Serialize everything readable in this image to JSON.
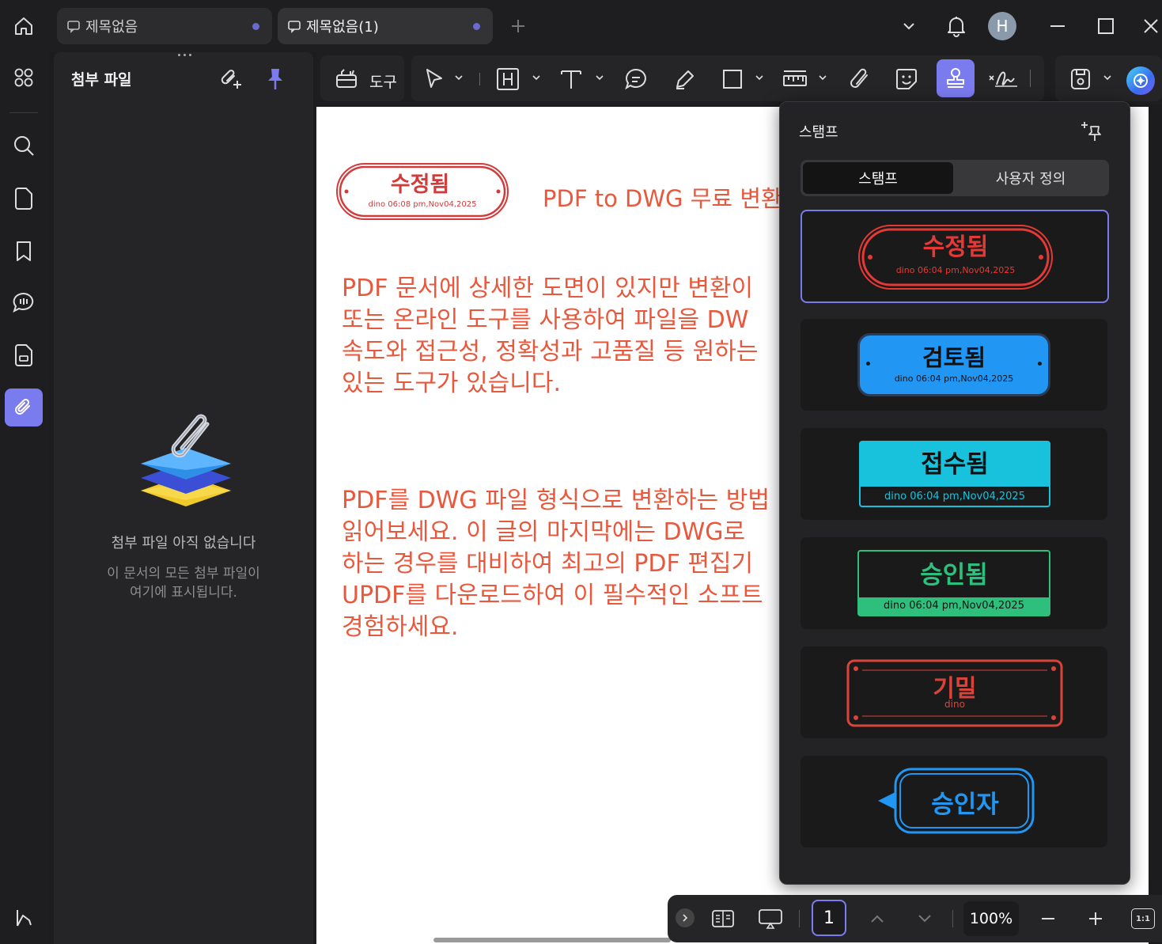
{
  "titlebar": {
    "tabs": [
      {
        "label": "제목없음"
      },
      {
        "label": "제목없음(1)"
      }
    ],
    "avatar_letter": "H"
  },
  "sidebar": {
    "title": "첨부 파일",
    "empty_title": "첨부 파일 아직 없습니다",
    "empty_desc_line1": "이 문서의 모든 첨부 파일이",
    "empty_desc_line2": "여기에 표시됩니다."
  },
  "toolbar": {
    "tools_label": "도구"
  },
  "document": {
    "stamp": {
      "title": "수정됨",
      "subtitle": "dino 06:08 pm,Nov04,2025"
    },
    "heading": "PDF to DWG 무료 변환",
    "para1": [
      "PDF 문서에 상세한 도면이 있지만 변환이",
      "또는 온라인 도구를 사용하여 파일을 DW",
      "속도와 접근성, 정확성과 고품질 등 원하는",
      "있는 도구가 있습니다."
    ],
    "para2": [
      "PDF를 DWG 파일 형식으로 변환하는 방법",
      "읽어보세요. 이 글의 마지막에는 DWG로",
      "하는 경우를 대비하여 최고의 PDF 편집기",
      "UPDF를 다운로드하여 이 필수적인 소프트",
      "경험하세요."
    ]
  },
  "stamp_panel": {
    "title": "스탬프",
    "tabs": [
      "스탬프",
      "사용자 정의"
    ],
    "stamps": [
      {
        "title": "수정됨",
        "subtitle": "dino 06:04 pm,Nov04,2025",
        "color": "#e53935"
      },
      {
        "title": "검토됨",
        "subtitle": "dino 06:04 pm,Nov04,2025",
        "color": "#2196f3"
      },
      {
        "title": "접수됨",
        "subtitle": "dino 06:04 pm,Nov04,2025",
        "color": "#19c2dc"
      },
      {
        "title": "승인됨",
        "subtitle": "dino 06:04 pm,Nov04,2025",
        "color": "#2ebf7d"
      },
      {
        "title": "기밀",
        "subtitle": "dino",
        "color": "#d9443a"
      },
      {
        "title": "승인자",
        "subtitle": "",
        "color": "#2196f3"
      }
    ]
  },
  "bottombar": {
    "page": "1",
    "zoom": "100%",
    "fit_label": "1:1"
  },
  "colors": {
    "accent": "#7b7bf0",
    "doc_text": "#e8583c"
  }
}
